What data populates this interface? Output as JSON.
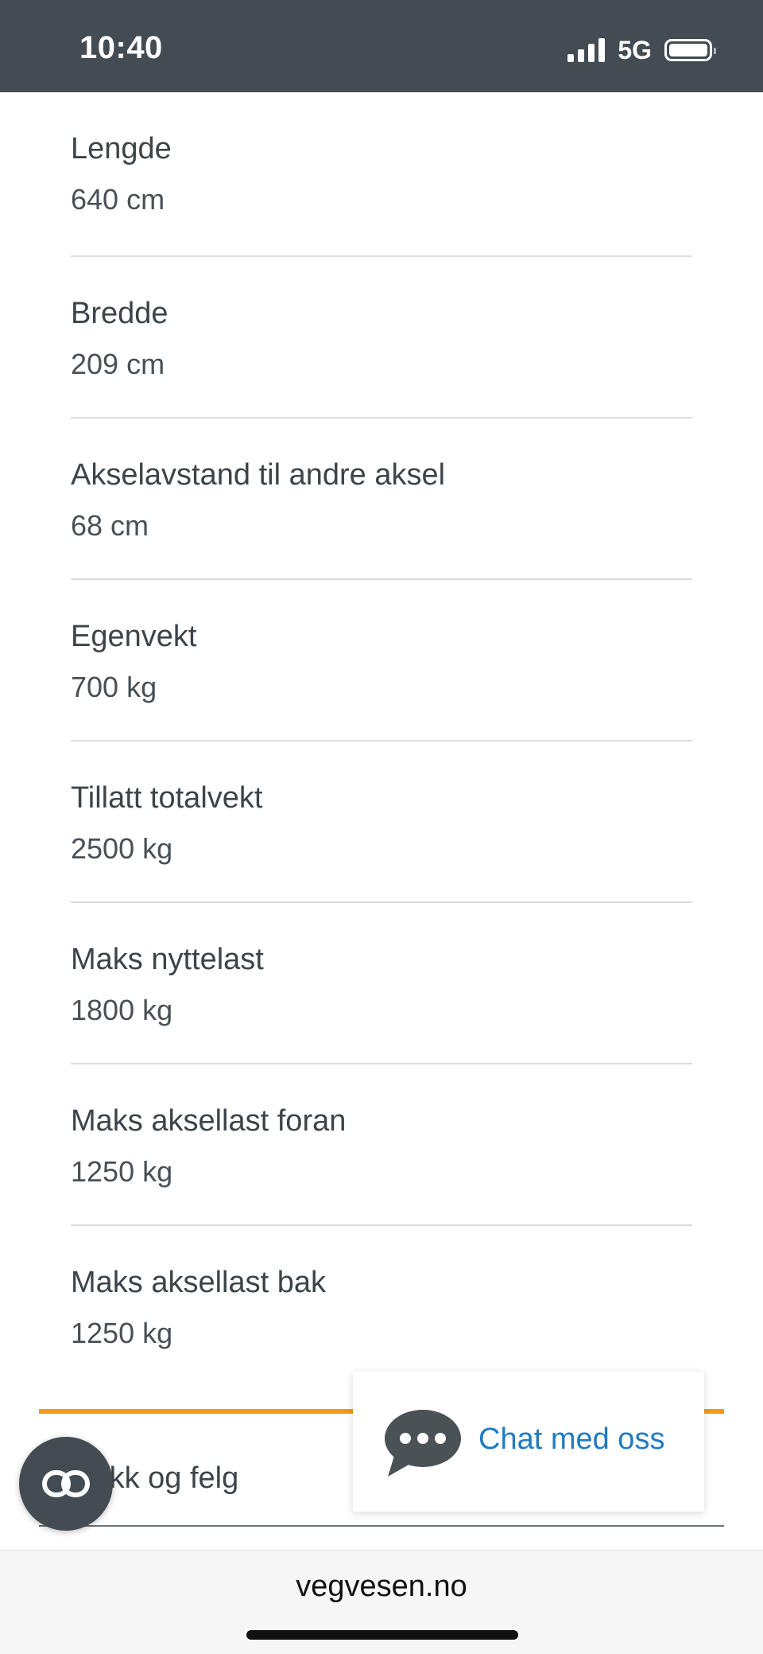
{
  "status_bar": {
    "time": "10:40",
    "network": "5G"
  },
  "specs": [
    {
      "label": "Lengde",
      "value": "640 cm"
    },
    {
      "label": "Bredde",
      "value": "209 cm"
    },
    {
      "label": "Akselavstand til andre aksel",
      "value": "68 cm"
    },
    {
      "label": "Egenvekt",
      "value": "700 kg"
    },
    {
      "label": "Tillatt totalvekt",
      "value": "2500 kg"
    },
    {
      "label": "Maks nyttelast",
      "value": "1800 kg"
    },
    {
      "label": "Maks aksellast foran",
      "value": "1250 kg"
    },
    {
      "label": "Maks aksellast bak",
      "value": "1250 kg"
    }
  ],
  "accordion": {
    "title": "Dekk og felg"
  },
  "chat": {
    "label": "Chat med oss"
  },
  "browser": {
    "url": "vegvesen.no"
  },
  "colors": {
    "status_bar_bg": "#434c52",
    "accent_orange": "#f29a1a",
    "link_blue": "#1f7bc4"
  },
  "icons": {
    "chat": "chat-bubble-icon",
    "accessibility": "accessibility-icon"
  }
}
